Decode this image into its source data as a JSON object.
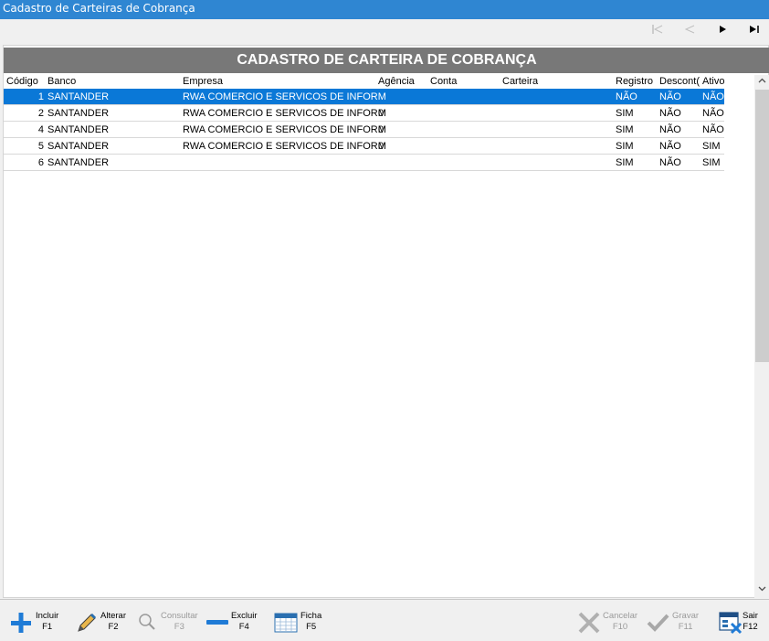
{
  "window": {
    "title": "Cadastro de Carteiras de Cobrança"
  },
  "nav": {
    "first": "first-icon",
    "prev": "prev-icon",
    "next": "next-icon",
    "last": "last-icon"
  },
  "header": {
    "title": "CADASTRO DE CARTEIRA DE COBRANÇA"
  },
  "grid": {
    "columns": {
      "codigo": "Código",
      "banco": "Banco",
      "empresa": "Empresa",
      "agencia": "Agência",
      "conta": "Conta",
      "carteira": "Carteira",
      "registro": "Registro",
      "desconto": "Descont(",
      "ativo": "Ativo"
    },
    "rows": [
      {
        "codigo": "1",
        "banco": "SANTANDER",
        "empresa": "RWA COMERCIO E SERVICOS DE INFORM",
        "agencia": "",
        "conta": "",
        "carteira": "",
        "registro": "NÃO",
        "desconto": "NÃO",
        "ativo": "NÃO"
      },
      {
        "codigo": "2",
        "banco": "SANTANDER",
        "empresa": "RWA COMERCIO E SERVICOS DE INFORM",
        "agencia": "0",
        "conta": "",
        "carteira": "",
        "registro": "SIM",
        "desconto": "NÃO",
        "ativo": "NÃO"
      },
      {
        "codigo": "4",
        "banco": "SANTANDER",
        "empresa": "RWA COMERCIO E SERVICOS DE INFORM",
        "agencia": "0",
        "conta": "",
        "carteira": "",
        "registro": "SIM",
        "desconto": "NÃO",
        "ativo": "NÃO"
      },
      {
        "codigo": "5",
        "banco": "SANTANDER",
        "empresa": "RWA COMERCIO E SERVICOS DE INFORM",
        "agencia": "0",
        "conta": "",
        "carteira": "",
        "registro": "SIM",
        "desconto": "NÃO",
        "ativo": "SIM"
      },
      {
        "codigo": "6",
        "banco": "SANTANDER",
        "empresa": "",
        "agencia": "",
        "conta": "",
        "carteira": "",
        "registro": "SIM",
        "desconto": "NÃO",
        "ativo": "SIM"
      }
    ]
  },
  "toolbar": {
    "incluir": {
      "label": "Incluir",
      "key": "F1"
    },
    "alterar": {
      "label": "Alterar",
      "key": "F2"
    },
    "consultar": {
      "label": "Consultar",
      "key": "F3"
    },
    "excluir": {
      "label": "Excluir",
      "key": "F4"
    },
    "ficha": {
      "label": "Ficha",
      "key": "F5"
    },
    "cancelar": {
      "label": "Cancelar",
      "key": "F10"
    },
    "gravar": {
      "label": "Gravar",
      "key": "F11"
    },
    "sair": {
      "label": "Sair",
      "key": "F12"
    }
  },
  "colors": {
    "titlebar": "#2f86d2",
    "header": "#787878",
    "selection": "#0a78d7",
    "add": "#1f7bd6"
  }
}
